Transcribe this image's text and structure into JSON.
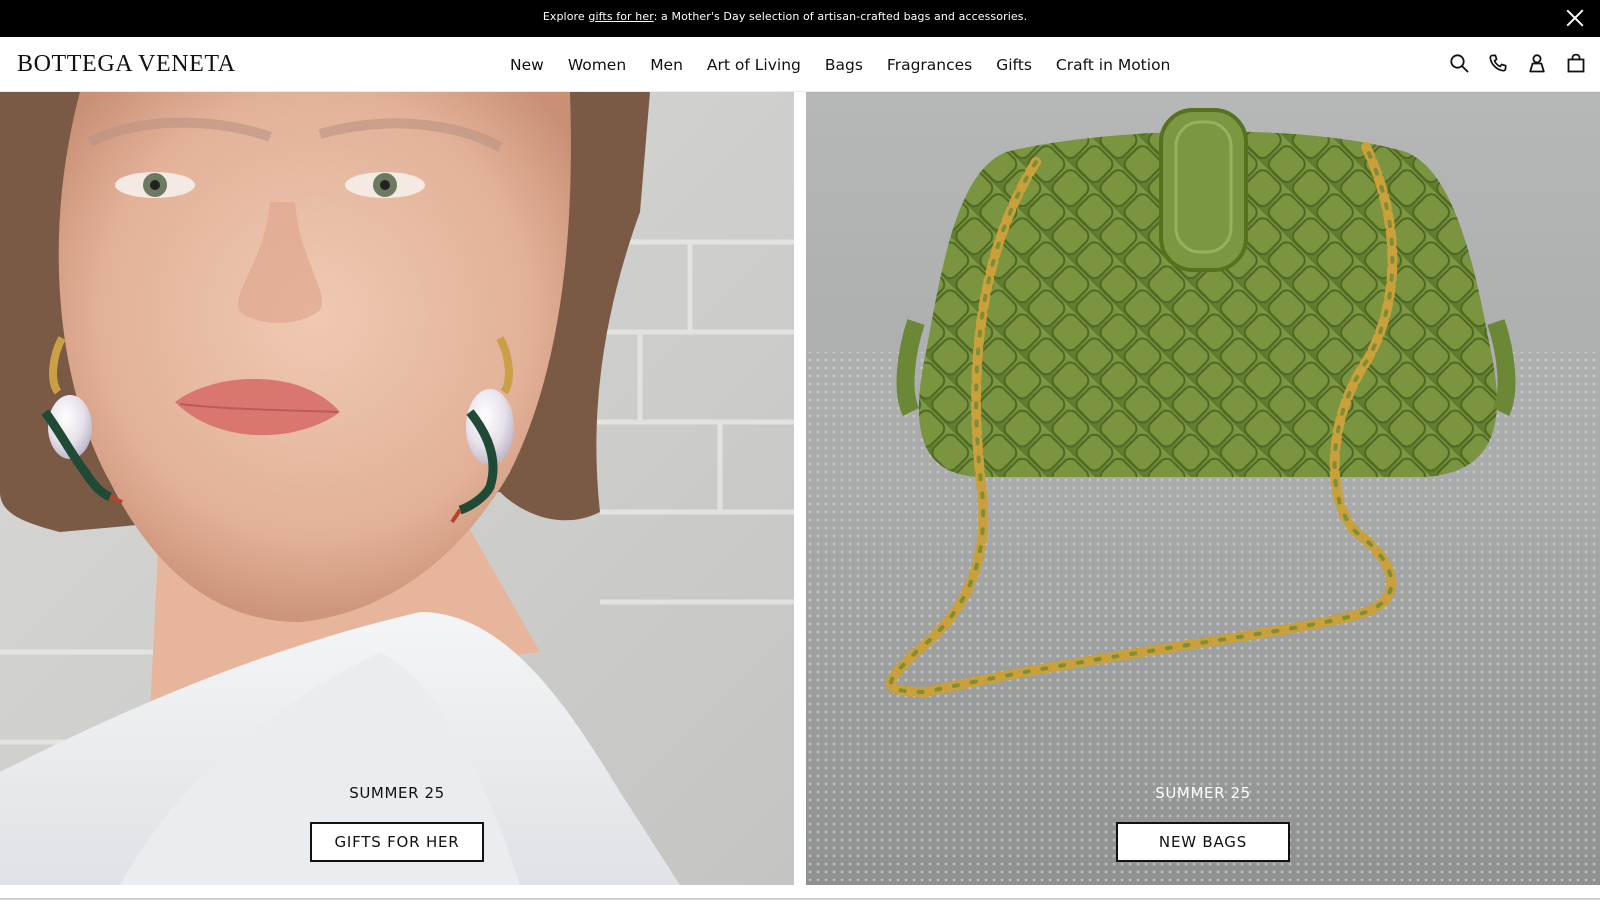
{
  "announcement": {
    "prefix": "Explore ",
    "link_text": "gifts for her",
    "suffix": ": a Mother's Day selection of artisan-crafted bags and accessories.",
    "close_icon": "close-icon"
  },
  "header": {
    "logo": "BOTTEGA VENETA",
    "nav": [
      "New",
      "Women",
      "Men",
      "Art of Living",
      "Bags",
      "Fragrances",
      "Gifts",
      "Craft in Motion"
    ],
    "icons": [
      "search-icon",
      "phone-icon",
      "account-icon",
      "shopping-bag-icon"
    ]
  },
  "hero": {
    "left": {
      "subtitle": "SUMMER 25",
      "button": "GIFTS FOR HER",
      "image": "model portrait with frog pearl earrings"
    },
    "right": {
      "subtitle": "SUMMER 25",
      "button": "NEW BAGS",
      "image": "green intrecciato clutch with gold chain"
    }
  },
  "colors": {
    "bar": "#000000",
    "bag_green": "#6f8a3a",
    "chain_gold": "#c9a03a"
  }
}
